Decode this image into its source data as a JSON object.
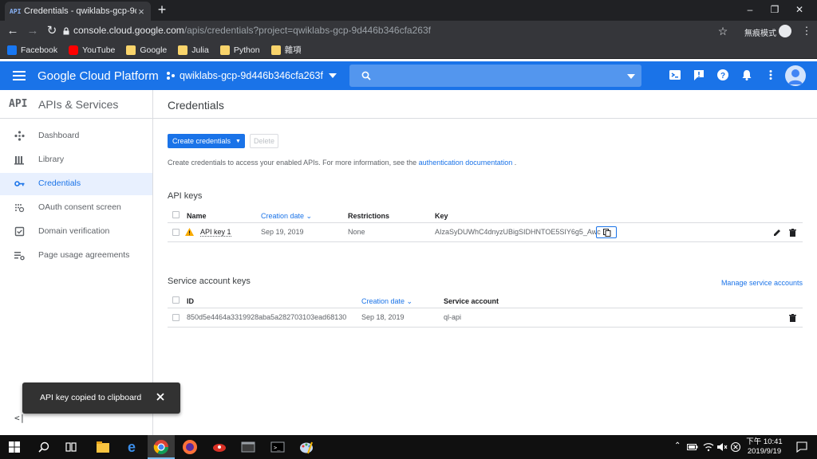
{
  "browser": {
    "tab_icon": "API",
    "tab_title": "Credentials - qwiklabs-gcp-9d",
    "tab_close": "×",
    "new_tab": "+",
    "url_host": "console.cloud.google.com",
    "url_path": "/apis/credentials?project=qwiklabs-gcp-9d446b346cfa263f",
    "incognito_label": "無痕模式",
    "bookmarks": [
      {
        "label": "Facebook",
        "icon": "facebook-icon",
        "color": "#1877f2"
      },
      {
        "label": "YouTube",
        "icon": "youtube-icon",
        "color": "#ff0000"
      },
      {
        "label": "Google",
        "icon": "folder-icon",
        "color": "#f9d46b"
      },
      {
        "label": "Julia",
        "icon": "folder-icon",
        "color": "#f9d46b"
      },
      {
        "label": "Python",
        "icon": "folder-icon",
        "color": "#f9d46b"
      },
      {
        "label": "雜項",
        "icon": "folder-icon",
        "color": "#f9d46b"
      }
    ]
  },
  "header": {
    "title": "Google Cloud Platform",
    "project": "qwiklabs-gcp-9d446b346cfa263f",
    "accent": "#1a73e8"
  },
  "sidebar": {
    "api_badge": "API",
    "title": "APIs & Services",
    "items": [
      {
        "label": "Dashboard",
        "icon": "dashboard-icon"
      },
      {
        "label": "Library",
        "icon": "library-icon"
      },
      {
        "label": "Credentials",
        "icon": "key-icon",
        "active": true
      },
      {
        "label": "OAuth consent screen",
        "icon": "oauth-icon"
      },
      {
        "label": "Domain verification",
        "icon": "checkbox-icon"
      },
      {
        "label": "Page usage agreements",
        "icon": "settings-list-icon"
      }
    ],
    "collapse": "<|"
  },
  "main": {
    "title": "Credentials",
    "create_button": "Create credentials",
    "delete_button": "Delete",
    "intro_text": "Create credentials to access your enabled APIs. For more information, see the ",
    "intro_link": "authentication documentation",
    "intro_end": " .",
    "api_keys": {
      "title": "API keys",
      "columns": [
        "Name",
        "Creation date",
        "Restrictions",
        "Key"
      ],
      "rows": [
        {
          "name": "API key 1",
          "date": "Sep 19, 2019",
          "restrictions": "None",
          "key": "AIzaSyDUWhC4dnyzUBigSIDHNTOE5SIY6g5_Awc"
        }
      ]
    },
    "service_keys": {
      "title": "Service account keys",
      "manage_link": "Manage service accounts",
      "columns": [
        "ID",
        "Creation date",
        "Service account"
      ],
      "rows": [
        {
          "id": "850d5e4464a3319928aba5a282703103ead68130",
          "date": "Sep 18, 2019",
          "account": "ql-api"
        }
      ]
    }
  },
  "toast": {
    "message": "API key copied to clipboard",
    "close": "×"
  },
  "taskbar": {
    "time": "下午 10:41",
    "date": "2019/9/19"
  }
}
